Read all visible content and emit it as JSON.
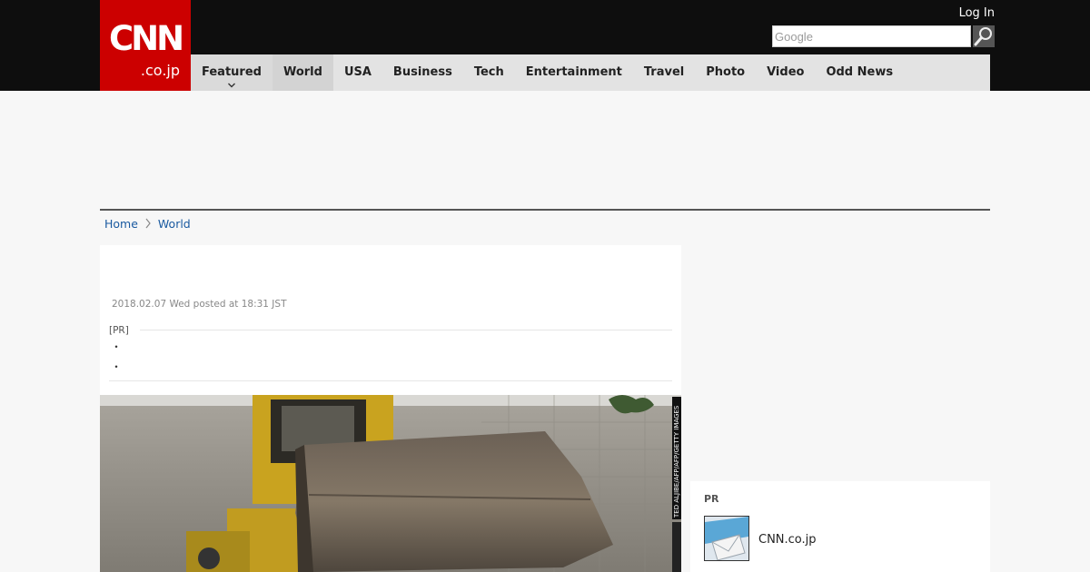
{
  "header": {
    "logo_main": "CNN",
    "logo_sub": ".co.jp",
    "login_label": "Log In",
    "search": {
      "placeholder": "Google"
    }
  },
  "nav": {
    "items": [
      {
        "label": "Featured"
      },
      {
        "label": "World"
      },
      {
        "label": "USA"
      },
      {
        "label": "Business"
      },
      {
        "label": "Tech"
      },
      {
        "label": "Entertainment"
      },
      {
        "label": "Travel"
      },
      {
        "label": "Photo"
      },
      {
        "label": "Video"
      },
      {
        "label": "Odd News"
      }
    ],
    "active": "World"
  },
  "breadcrumb": {
    "items": [
      {
        "label": "Home"
      },
      {
        "label": "World"
      }
    ]
  },
  "article": {
    "date": "2018.02.07 Wed posted at 18:31 JST",
    "pr_label": "[PR]",
    "bullets": [
      "・",
      "・"
    ],
    "photo_credit": "TED ALJIBE/AFP/AFP/GETTY IMAGES"
  },
  "sidebar": {
    "pr_title": "PR",
    "pr_item_label": "CNN.co.jp"
  },
  "colors": {
    "brand_red": "#cc0000",
    "topbar_bg": "#0e0e0e",
    "nav_bg": "#e3e3e3",
    "link_blue": "#1a5aa0"
  },
  "icons": [
    "search-icon",
    "chevron-down-icon",
    "chevron-right-icon"
  ]
}
